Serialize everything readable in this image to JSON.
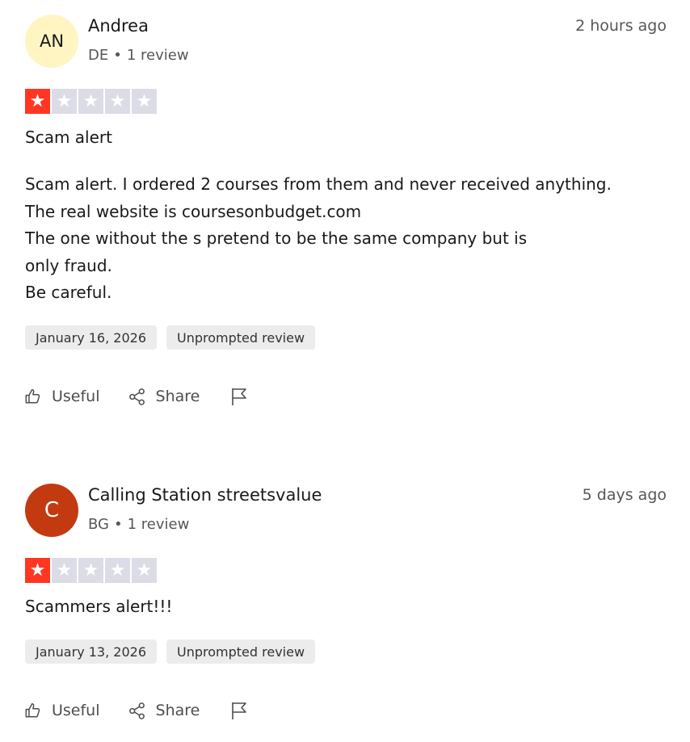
{
  "reviews": [
    {
      "avatar_initials": "AN",
      "avatar_bg": "#fff5c2",
      "avatar_color": "#191919",
      "name": "Andrea",
      "country": "DE",
      "review_count": "1 review",
      "time": "2 hours ago",
      "rating": 1,
      "title": "Scam alert",
      "body": [
        "Scam alert. I ordered 2 courses from them and never received anything.",
        "The real website is coursesonbudget.com",
        "The one without the s pretend to be the same company but is",
        "only fraud.",
        "Be careful."
      ],
      "date": "January 16, 2026",
      "tag": "Unprompted review",
      "useful_label": "Useful",
      "share_label": "Share"
    },
    {
      "avatar_initials": "C",
      "avatar_bg": "#c33a10",
      "avatar_color": "#ffffff",
      "name": "Calling Station streetsvalue",
      "country": "BG",
      "review_count": "1 review",
      "time": "5 days ago",
      "rating": 1,
      "title": "Scammers alert!!!",
      "body": [],
      "date": "January 13, 2026",
      "tag": "Unprompted review",
      "useful_label": "Useful",
      "share_label": "Share"
    }
  ],
  "colors": {
    "star_filled": "#ff3722",
    "star_empty": "#dcdce6"
  },
  "icons": {
    "star": "★",
    "separator": "•"
  }
}
